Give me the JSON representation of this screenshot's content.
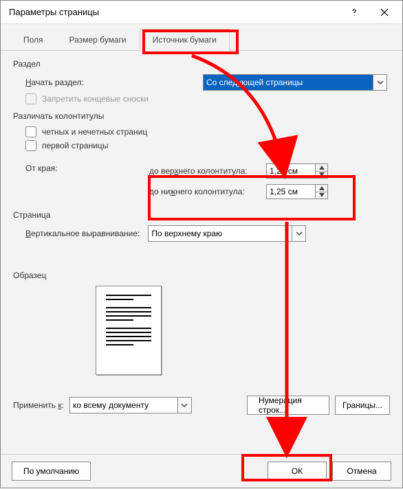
{
  "title": "Параметры страницы",
  "tabs": {
    "fields": "Поля",
    "paper_size": "Размер бумаги",
    "paper_source": "Источник бумаги"
  },
  "section": {
    "label": "Раздел",
    "start_label_pre": "Н",
    "start_label_post": "ачать раздел:",
    "start_value": "Со следующей страницы",
    "suppress_endnotes": "Запретить концевые сноски"
  },
  "headers": {
    "label": "Различать колонтитулы",
    "odd_even": "четных и нечетных страниц",
    "first_page": "первой страницы",
    "from_edge": "От края:",
    "header_label_pre": "до вер",
    "header_label_u": "х",
    "header_label_post": "него колонтитула:",
    "footer_label_pre": "до ни",
    "footer_label_u": "ж",
    "footer_label_post": "него колонтитула:",
    "header_value": "1,25 см",
    "footer_value": "1,25 см"
  },
  "page": {
    "label": "Страница",
    "valign_pre": "В",
    "valign_post": "ертикальное выравнивание:",
    "valign_value": "По верхнему краю"
  },
  "preview_label": "Образец",
  "apply": {
    "label_pre": "Применить ",
    "label_u": "к",
    "label_post": ":",
    "value": "ко всему документу"
  },
  "buttons": {
    "line_numbers": "Нумерация строк...",
    "borders": "Границы...",
    "defaults": "По умолчанию",
    "ok": "ОК",
    "cancel": "Отмена"
  }
}
